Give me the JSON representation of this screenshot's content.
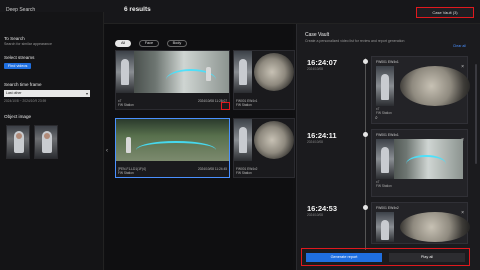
{
  "app": {
    "title": "Deep Search",
    "results_title": "6 results",
    "case_vault_button": "Case Vault (3)"
  },
  "sidebar": {
    "to_search": "To Search",
    "to_search_sub": "Search for similar appearance",
    "select_streams": "Select streams",
    "streams_button": "Find videos",
    "time_frame_label": "Search time frame",
    "time_frame_value": "Last other",
    "time_frame_range": "2024/10/8 ~ 2024/10/9 23:59",
    "object_image_label": "Object image"
  },
  "filters": [
    {
      "label": "All",
      "active": true
    },
    {
      "label": "Face",
      "active": false
    },
    {
      "label": "Body",
      "active": false
    }
  ],
  "results": [
    {
      "name": "x7",
      "sub": "FW Station",
      "right": "2024/10/08 11:28:07",
      "right2": "Face Score: 1.00 (2)"
    },
    {
      "name": "FW001 EW4v1",
      "sub": "FW Station",
      "right": "",
      "right2": ""
    },
    {
      "name": "[PEN-F1-LD1(1F)4]",
      "sub": "FW Station",
      "right": "2024/10/08 11:24:45",
      "right2": "Body Score: 1.00 (1)"
    },
    {
      "name": "FW001 EW4v2",
      "sub": "FW Station",
      "right": "",
      "right2": ""
    }
  ],
  "vault": {
    "title": "Case Vault",
    "subtitle": "Create a personalized video list for review and report generation",
    "clear_all": "Clear all",
    "items": [
      {
        "time": "16:24:07",
        "date": "2024/10/08",
        "camera": "FW001 EW4v1",
        "meta1": "x7",
        "meta2": "FW Station"
      },
      {
        "time": "16:24:11",
        "date": "2024/10/08",
        "camera": "FW001 EW4v1",
        "meta1": "x7",
        "meta2": "FW Station"
      },
      {
        "time": "16:24:53",
        "date": "2024/10/08",
        "camera": "FW001 EW4v2",
        "meta1": "",
        "meta2": ""
      }
    ],
    "generate_report": "Generate report",
    "play_all": "Play all"
  },
  "icons": {
    "chevron": "chevron-left-icon",
    "close": "close-icon",
    "zoom": "magnify-icon"
  },
  "colors": {
    "accent": "#1f6fe0",
    "highlight": "#e0191e",
    "track": "#44e3ff"
  }
}
